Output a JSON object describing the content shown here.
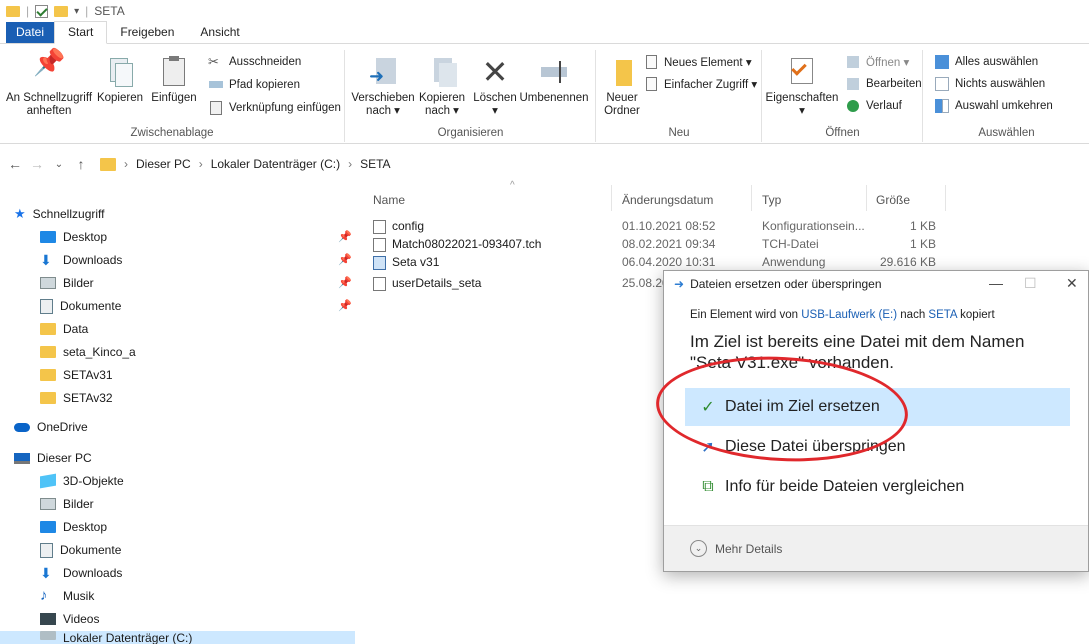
{
  "window": {
    "title": "SETA"
  },
  "tabs": [
    "Datei",
    "Start",
    "Freigeben",
    "Ansicht"
  ],
  "ribbon": {
    "clipboard": {
      "label": "Zwischenablage",
      "pin": "An Schnellzugriff\nanheften",
      "copy": "Kopieren",
      "paste": "Einfügen",
      "cut": "Ausschneiden",
      "copy_path": "Pfad kopieren",
      "paste_shortcut": "Verknüpfung einfügen"
    },
    "organize": {
      "label": "Organisieren",
      "move": "Verschieben\nnach ▾",
      "copy_to": "Kopieren\nnach ▾",
      "delete": "Löschen\n▾",
      "rename": "Umbenennen"
    },
    "new": {
      "label": "Neu",
      "new_folder": "Neuer\nOrdner",
      "new_item": "Neues Element ▾",
      "easy_access": "Einfacher Zugriff ▾"
    },
    "open": {
      "label": "Öffnen",
      "properties": "Eigenschaften\n▾",
      "open": "Öffnen ▾",
      "edit": "Bearbeiten",
      "history": "Verlauf"
    },
    "select": {
      "label": "Auswählen",
      "select_all": "Alles auswählen",
      "select_none": "Nichts auswählen",
      "invert": "Auswahl umkehren"
    }
  },
  "address": {
    "crumbs": [
      "Dieser PC",
      "Lokaler Datenträger (C:)",
      "SETA"
    ]
  },
  "nav": {
    "quick_access": "Schnellzugriff",
    "items": [
      "Desktop",
      "Downloads",
      "Bilder",
      "Dokumente",
      "Data",
      "seta_Kinco_a",
      "SETAv31",
      "SETAv32"
    ],
    "onedrive": "OneDrive",
    "this_pc": "Dieser PC",
    "pc_items": [
      "3D-Objekte",
      "Bilder",
      "Desktop",
      "Dokumente",
      "Downloads",
      "Musik",
      "Videos",
      "Lokaler Datenträger (C:)"
    ]
  },
  "files": {
    "headers": {
      "name": "Name",
      "date": "Änderungsdatum",
      "type": "Typ",
      "size": "Größe"
    },
    "rows": [
      {
        "name": "config",
        "date": "01.10.2021 08:52",
        "type": "Konfigurationsein...",
        "size": "1 KB"
      },
      {
        "name": "Match08022021-093407.tch",
        "date": "08.02.2021 09:34",
        "type": "TCH-Datei",
        "size": "1 KB"
      },
      {
        "name": "Seta v31",
        "date": "06.04.2020 10:31",
        "type": "Anwendung",
        "size": "29.616 KB"
      },
      {
        "name": "userDetails_seta",
        "date": "25.08.20",
        "type": "",
        "size": ""
      }
    ]
  },
  "dialog": {
    "title": "Dateien ersetzen oder überspringen",
    "msg_pre": "Ein Element wird von ",
    "msg_src": "USB-Laufwerk (E:)",
    "msg_mid": " nach ",
    "msg_dst": "SETA",
    "msg_post": " kopiert",
    "headline": "Im Ziel ist bereits eine Datei mit dem Namen \"Seta V31.exe\" vorhanden.",
    "opt_replace": "Datei im Ziel ersetzen",
    "opt_skip": "Diese Datei überspringen",
    "opt_compare": "Info für beide Dateien vergleichen",
    "more": "Mehr Details"
  },
  "colors": {
    "accent": "#1a5fb4",
    "highlight": "#cde8ff",
    "annotation": "#e0282c"
  }
}
